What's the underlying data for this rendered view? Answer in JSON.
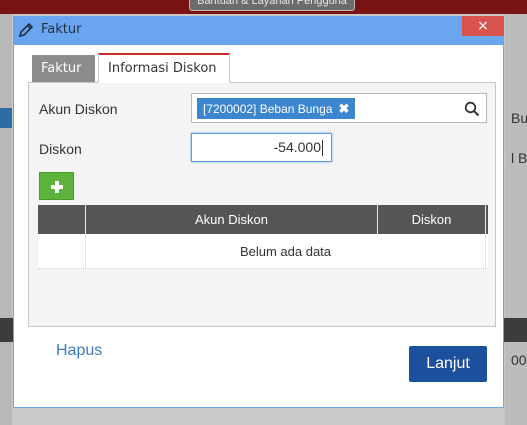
{
  "background": {
    "top_button_label": "Bantuan & Layanan Pengguna",
    "right_text_1": "Bu",
    "right_text_2": "l B",
    "right_text_3": "000"
  },
  "modal": {
    "title": "Faktur",
    "close_label": "×",
    "tabs": [
      {
        "label": "Faktur",
        "active": false
      },
      {
        "label": "Informasi Diskon",
        "active": true
      }
    ],
    "form": {
      "akun_label": "Akun Diskon",
      "akun_tag": "[7200002] Beban Bunga",
      "akun_tag_remove": "✖",
      "diskon_label": "Diskon",
      "diskon_value": "-54.000"
    },
    "table": {
      "columns": [
        "",
        "Akun Diskon",
        "Diskon"
      ],
      "empty_message": "Belum ada data"
    },
    "footer": {
      "delete_label": "Hapus",
      "next_label": "Lanjut"
    }
  },
  "colors": {
    "modal_frame": "#6aa6ef",
    "close": "#d9534f",
    "tag": "#3c86d0",
    "add_button": "#5cb23a",
    "primary_button": "#1c4f9c",
    "link": "#3a7cc0",
    "tab_accent": "#c9302c"
  }
}
